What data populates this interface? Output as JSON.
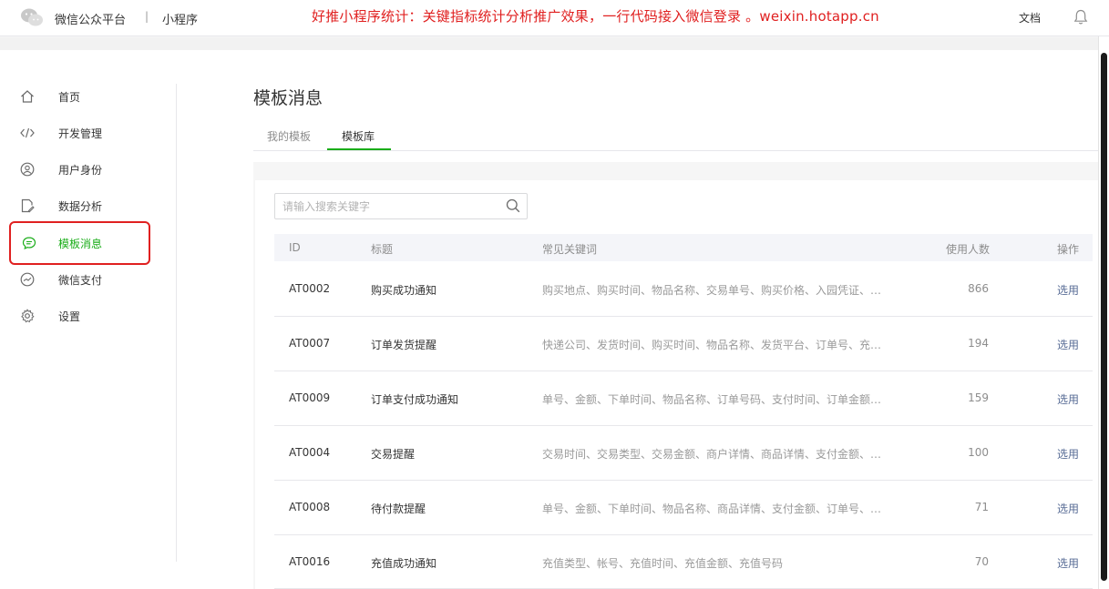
{
  "topbar": {
    "brand": "微信公众平台",
    "separator": "|",
    "sub_brand": "小程序",
    "banner": "好推小程序统计：关键指标统计分析推广效果，一行代码接入微信登录 。weixin.hotapp.cn",
    "doc_link": "文档"
  },
  "colors": {
    "accent_green": "#1aad19",
    "banner_red": "#e02020",
    "link_blue": "#576b95"
  },
  "sidebar": {
    "items": [
      {
        "label": "首页",
        "icon": "home-icon"
      },
      {
        "label": "开发管理",
        "icon": "code-icon"
      },
      {
        "label": "用户身份",
        "icon": "user-icon"
      },
      {
        "label": "数据分析",
        "icon": "document-edit-icon"
      },
      {
        "label": "模板消息",
        "icon": "chat-bubble-icon",
        "active": true
      },
      {
        "label": "微信支付",
        "icon": "payment-icon"
      },
      {
        "label": "设置",
        "icon": "gear-icon"
      }
    ]
  },
  "main": {
    "title": "模板消息",
    "tabs": [
      {
        "label": "我的模板"
      },
      {
        "label": "模板库",
        "active": true
      }
    ],
    "search": {
      "placeholder": "请输入搜索关键字",
      "value": ""
    },
    "table": {
      "headers": [
        "ID",
        "标题",
        "常见关键词",
        "使用人数",
        "操作"
      ],
      "rows": [
        {
          "id": "AT0002",
          "title": "购买成功通知",
          "keywords": "购买地点、购买时间、物品名称、交易单号、购买价格、入园凭证、…",
          "count": "866",
          "action": "选用"
        },
        {
          "id": "AT0007",
          "title": "订单发货提醒",
          "keywords": "快递公司、发货时间、购买时间、物品名称、发货平台、订单号、充…",
          "count": "194",
          "action": "选用"
        },
        {
          "id": "AT0009",
          "title": "订单支付成功通知",
          "keywords": "单号、金额、下单时间、物品名称、订单号码、支付时间、订单金额…",
          "count": "159",
          "action": "选用"
        },
        {
          "id": "AT0004",
          "title": "交易提醒",
          "keywords": "交易时间、交易类型、交易金额、商户详情、商品详情、支付金额、…",
          "count": "100",
          "action": "选用"
        },
        {
          "id": "AT0008",
          "title": "待付款提醒",
          "keywords": "单号、金额、下单时间、物品名称、商品详情、支付金额、订单号、…",
          "count": "71",
          "action": "选用"
        },
        {
          "id": "AT0016",
          "title": "充值成功通知",
          "keywords": "充值类型、帐号、充值时间、充值金额、充值号码",
          "count": "70",
          "action": "选用"
        }
      ]
    }
  }
}
